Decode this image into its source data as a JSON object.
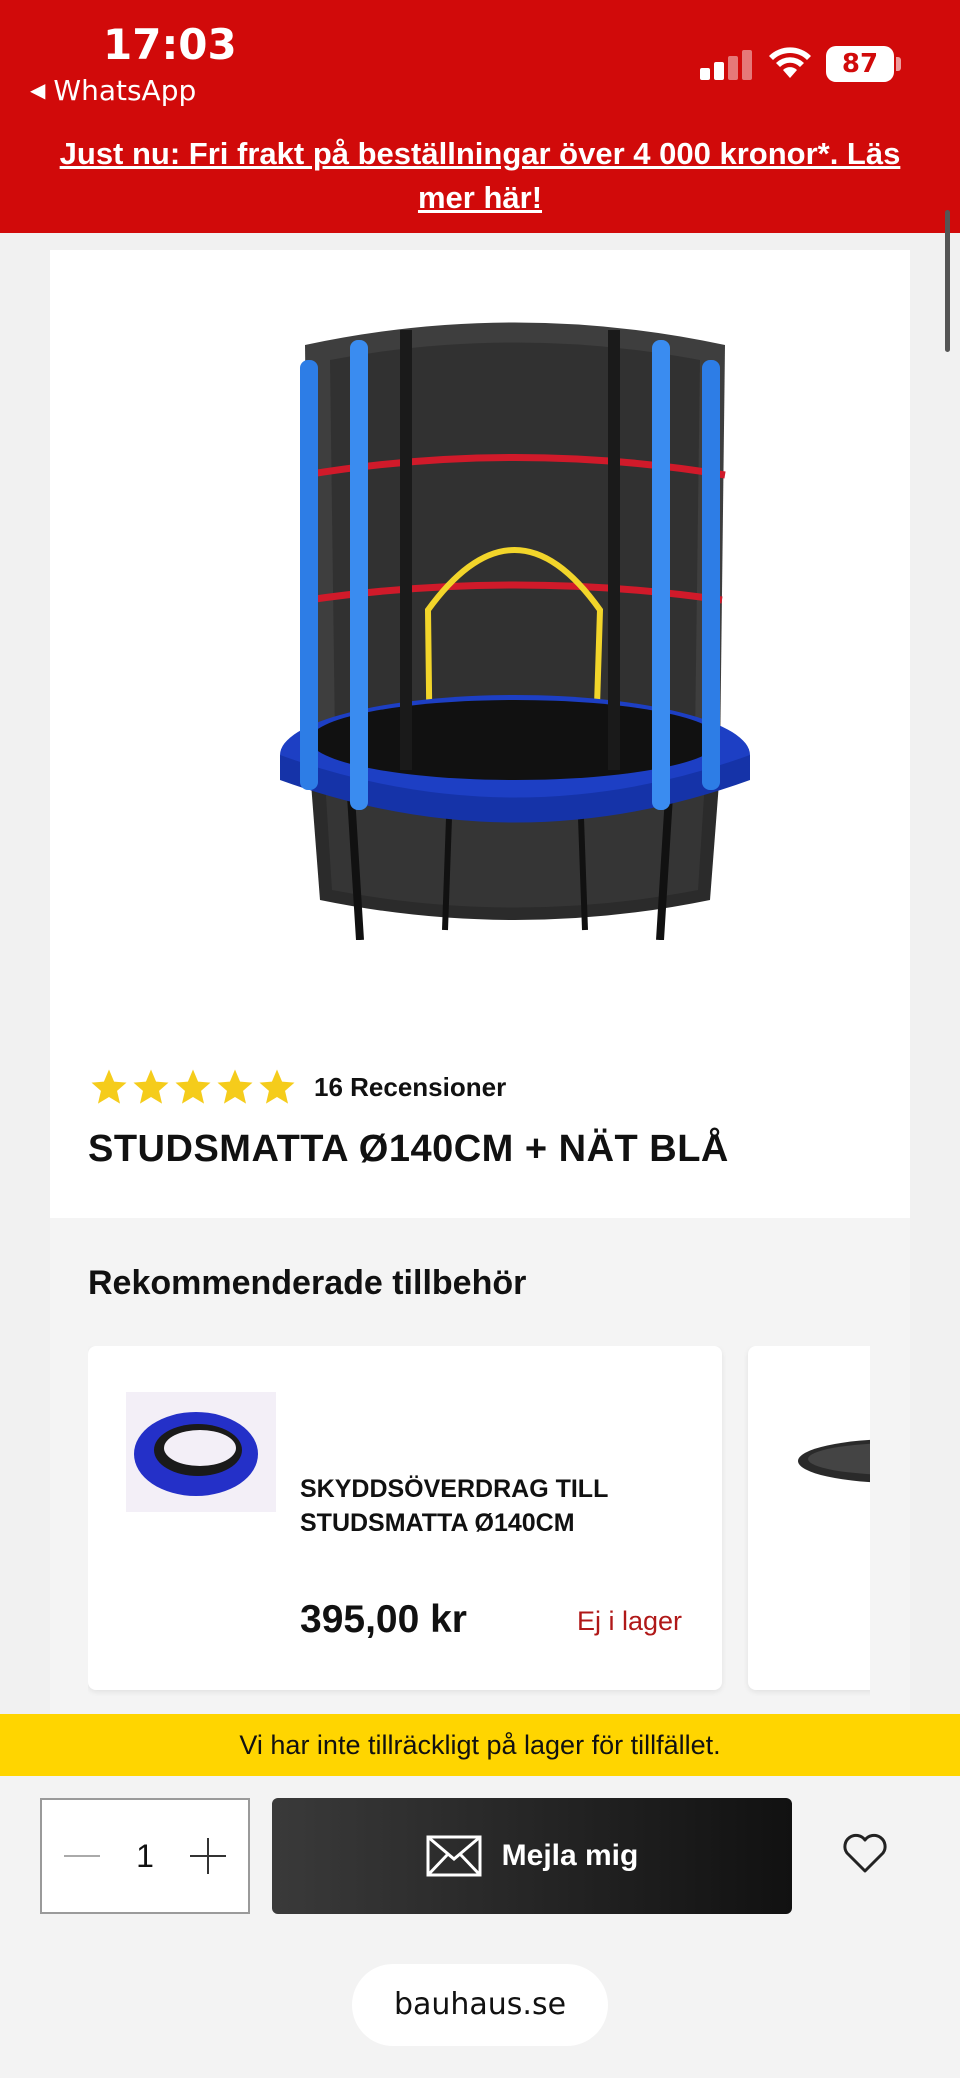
{
  "status_bar": {
    "time": "17:03",
    "back_app": "WhatsApp",
    "battery": "87"
  },
  "banner": {
    "text": "Just nu: Fri frakt på beställningar över 4 000 kronor*. Läs mer här!",
    "color": "#d10a0a"
  },
  "product": {
    "image_icon": "trampoline-image",
    "rating_stars": 5,
    "review_count_label": "16 Recensioner",
    "title": "STUDSMATTA Ø140CM + NÄT BLÅ"
  },
  "recommended": {
    "heading": "Rekommenderade tillbehör",
    "items": [
      {
        "name": "SKYDDSÖVERDRAG TILL STUDSMATTA Ø140CM",
        "price": "395,00 kr",
        "stock": "Ej i lager",
        "stock_color": "#b01818"
      }
    ]
  },
  "stock_notice": "Vi har inte tillräckligt på lager för tillfället.",
  "purchase": {
    "quantity": "1",
    "mail_button_label": "Mejla mig"
  },
  "browser": {
    "url": "bauhaus.se"
  }
}
